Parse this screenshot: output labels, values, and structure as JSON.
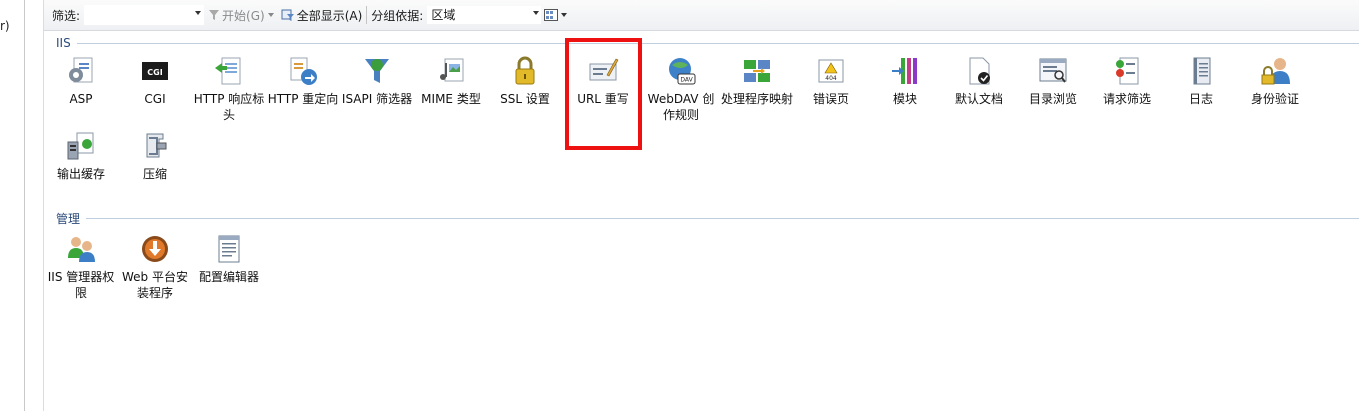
{
  "left_pane": {
    "fragment": "r)"
  },
  "toolbar": {
    "filter_label": "筛选:",
    "start_label": "开始(G)",
    "show_all_label": "全部显示(A)",
    "group_by_label": "分组依据:",
    "group_by_value": "区域"
  },
  "sections": {
    "iis": {
      "title": "IIS",
      "items": [
        {
          "label": "ASP",
          "icon": "asp-icon"
        },
        {
          "label": "CGI",
          "icon": "cgi-icon"
        },
        {
          "label": "HTTP 响应标头",
          "icon": "http-response-headers-icon"
        },
        {
          "label": "HTTP 重定向",
          "icon": "http-redirect-icon"
        },
        {
          "label": "ISAPI 筛选器",
          "icon": "isapi-filters-icon"
        },
        {
          "label": "MIME 类型",
          "icon": "mime-types-icon"
        },
        {
          "label": "SSL 设置",
          "icon": "ssl-lock-icon"
        },
        {
          "label": "URL 重写",
          "icon": "url-rewrite-icon"
        },
        {
          "label": "WebDAV 创作规则",
          "icon": "webdav-icon"
        },
        {
          "label": "处理程序映射",
          "icon": "handler-mappings-icon"
        },
        {
          "label": "错误页",
          "icon": "error-pages-icon"
        },
        {
          "label": "模块",
          "icon": "modules-icon"
        },
        {
          "label": "默认文档",
          "icon": "default-document-icon"
        },
        {
          "label": "目录浏览",
          "icon": "directory-browsing-icon"
        },
        {
          "label": "请求筛选",
          "icon": "request-filtering-icon"
        },
        {
          "label": "日志",
          "icon": "logging-icon"
        },
        {
          "label": "身份验证",
          "icon": "authentication-icon"
        },
        {
          "label": "输出缓存",
          "icon": "output-caching-icon"
        },
        {
          "label": "压缩",
          "icon": "compression-icon"
        }
      ]
    },
    "management": {
      "title": "管理",
      "items": [
        {
          "label": "IIS 管理器权限",
          "icon": "iis-manager-permissions-icon"
        },
        {
          "label": "Web 平台安装程序",
          "icon": "web-platform-installer-icon"
        },
        {
          "label": "配置编辑器",
          "icon": "configuration-editor-icon"
        }
      ]
    }
  },
  "highlight_color": "#ee1111"
}
